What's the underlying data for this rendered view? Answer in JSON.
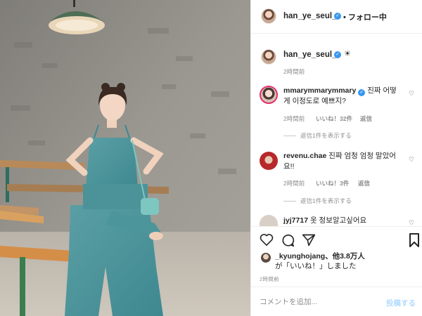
{
  "post": {
    "username": "han_ye_seul_",
    "follow_label": "• フォロー中",
    "caption_emoji": "☀",
    "posted_ago": "2時間前"
  },
  "comments": [
    {
      "username": "mmarymmarymmary",
      "verified": true,
      "text": " 진짜 어떻게 이정도로 예쁘지?",
      "time": "2時間前",
      "likes": "いいね！32件",
      "reply": "返信",
      "view_replies": "返信1件を表示する"
    },
    {
      "username": "revenu.chae",
      "verified": false,
      "text": " 진짜 엄청 엄청 말았어요!!",
      "time": "2時間前",
      "likes": "いいね！3件",
      "reply": "返信",
      "view_replies": "返信1件を表示する"
    },
    {
      "username": "jyj7717",
      "verified": false,
      "text": " 옷 정보알고싶어요"
    }
  ],
  "likes_summary": {
    "name": "_kyunghojang",
    "others": "、他3.8万人",
    "suffix": "が「いいね！」しました"
  },
  "post_time": "2時間前",
  "comment_box": {
    "placeholder": "コメントを追加...",
    "post_label": "投稿する"
  },
  "icons": [
    "heart-icon",
    "comment-icon",
    "share-icon",
    "bookmark-icon",
    "verified-badge-icon",
    "sun-emoji"
  ],
  "colors": {
    "verified": "#3897f0",
    "post_button_disabled": "#b3dbff",
    "meta_text": "#8e8e8e"
  }
}
